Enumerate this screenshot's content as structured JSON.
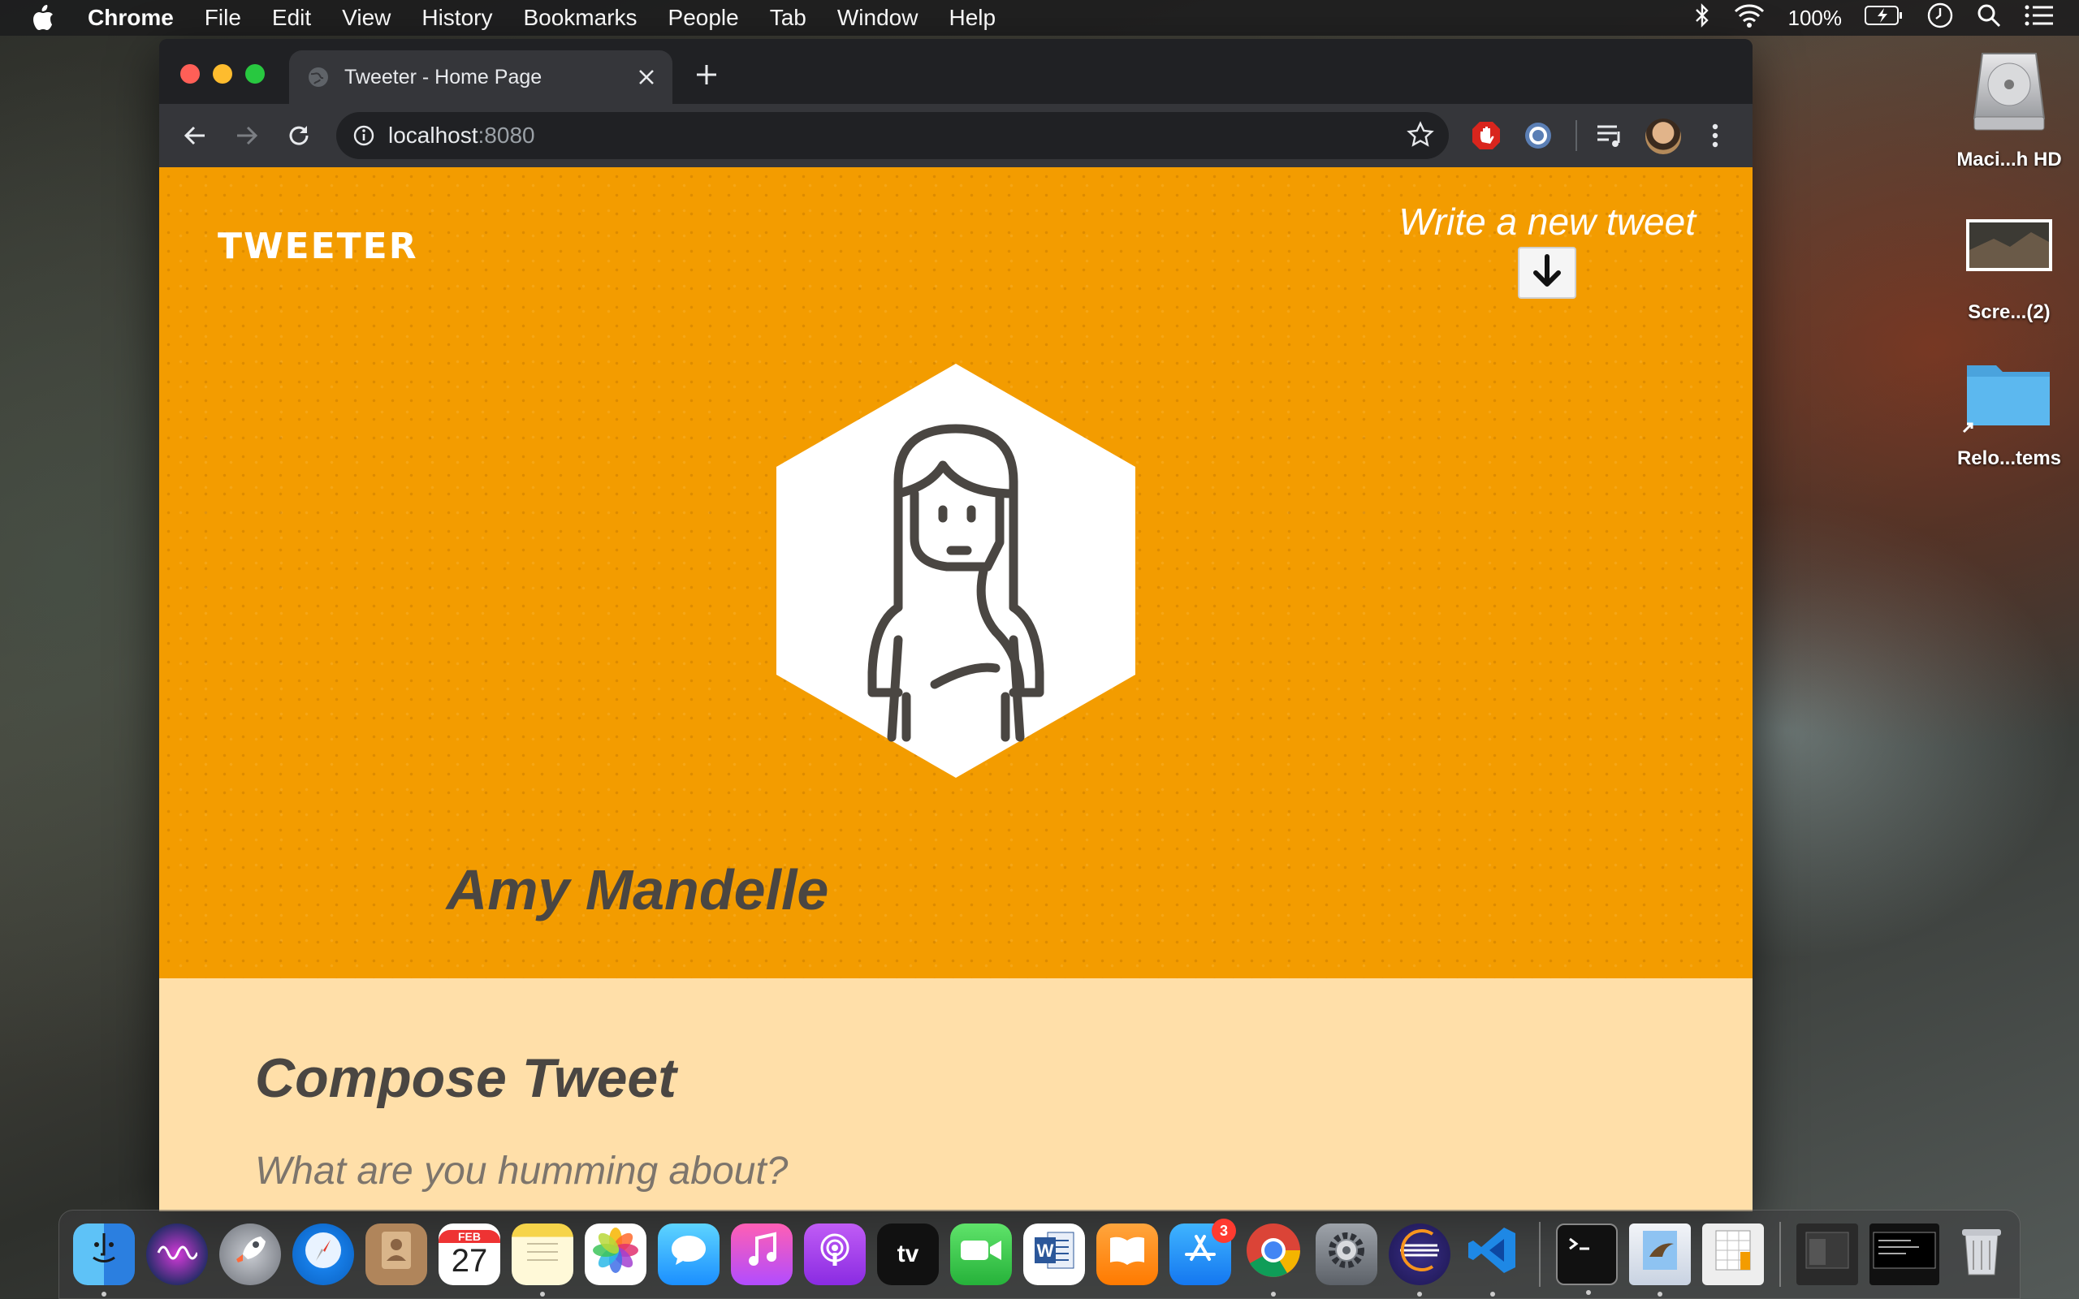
{
  "menubar": {
    "app_name": "Chrome",
    "items": [
      "File",
      "Edit",
      "View",
      "History",
      "Bookmarks",
      "People",
      "Tab",
      "Window",
      "Help"
    ],
    "battery": "100%"
  },
  "browser": {
    "tab_title": "Tweeter - Home Page",
    "url_host": "localhost",
    "url_port": ":8080"
  },
  "page": {
    "brand": "TWEETER",
    "compose_toggle_label": "Write a new tweet",
    "profile_name": "Amy Mandelle",
    "compose_heading": "Compose Tweet",
    "compose_placeholder": "What are you humming about?",
    "accent_color": "#f39c00",
    "compose_bg": "#ffdfa9"
  },
  "desktop": {
    "icons": [
      {
        "label": "Maci...h HD",
        "icon": "hard-drive-icon"
      },
      {
        "label": "Scre...(2)",
        "icon": "screenshot-thumbnail-icon"
      },
      {
        "label": "Relo...tems",
        "icon": "folder-alias-icon"
      }
    ]
  },
  "dock": {
    "app_store_badge": "3",
    "calendar_month": "FEB",
    "calendar_day": "27"
  }
}
